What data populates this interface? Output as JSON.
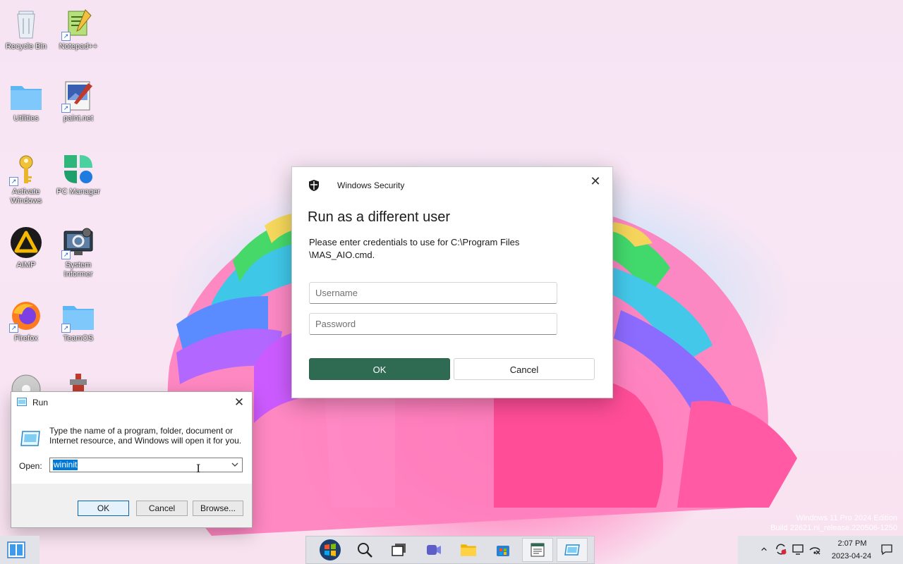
{
  "desktop": {
    "icons": [
      {
        "label": "Recycle Bin",
        "icon": "recycle-bin-icon"
      },
      {
        "label": "Notepad++",
        "icon": "notepad-plus-plus-icon"
      },
      {
        "label": "Utilities",
        "icon": "folder-icon"
      },
      {
        "label": "paint.net",
        "icon": "paint-net-icon"
      },
      {
        "label": "Activate Windows",
        "icon": "key-icon"
      },
      {
        "label": "PC Manager",
        "icon": "pc-manager-icon"
      },
      {
        "label": "AIMP",
        "icon": "aimp-icon"
      },
      {
        "label": "System Informer",
        "icon": "system-informer-icon"
      },
      {
        "label": "Firefox",
        "icon": "firefox-icon"
      },
      {
        "label": "TeamOS",
        "icon": "folder-icon"
      }
    ]
  },
  "security_dialog": {
    "app_name": "Windows Security",
    "title": "Run as a different user",
    "message": "Please enter credentials to use for C:\\Program Files \\MAS_AIO.cmd.",
    "username_placeholder": "Username",
    "password_placeholder": "Password",
    "ok_label": "OK",
    "cancel_label": "Cancel",
    "close_glyph": "✕",
    "accent": "#2e6b52"
  },
  "run_dialog": {
    "title": "Run",
    "description": "Type the name of a program, folder, document or Internet resource, and Windows will open it for you.",
    "open_label": "Open:",
    "open_value": "wininit",
    "ok_label": "OK",
    "cancel_label": "Cancel",
    "browse_label": "Browse...",
    "close_glyph": "✕"
  },
  "watermark": {
    "line1": "Windows 11 Pro 2024 Edition",
    "line2": "Build 22621.ni_release.220506-1250"
  },
  "taskbar": {
    "apps": [
      "start-icon",
      "search-icon",
      "task-view-icon",
      "teams-chat-icon",
      "file-explorer-icon",
      "microsoft-store-icon",
      "notepad-window-icon",
      "run-window-icon"
    ],
    "tray": [
      "chevron-up-icon",
      "sync-icon",
      "display-icon",
      "network-icon"
    ],
    "time": "2:07 PM",
    "date": "2023-04-24"
  }
}
